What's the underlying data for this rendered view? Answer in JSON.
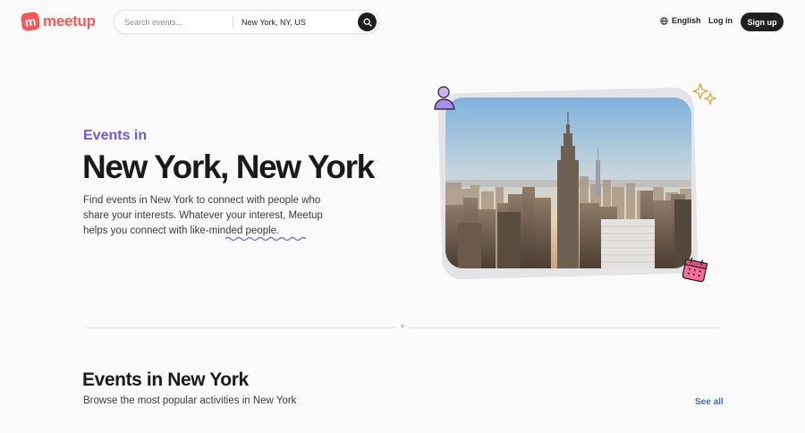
{
  "brand": {
    "logo_text": "meetup",
    "logo_mark": "m",
    "color": "#f65858"
  },
  "search": {
    "placeholder": "Search events...",
    "location_value": "New York, NY, US",
    "button_icon": "search-icon"
  },
  "nav": {
    "language_icon": "globe-icon",
    "language": "English",
    "login": "Log in",
    "signup": "Sign up"
  },
  "hero": {
    "eyebrow": "Events in",
    "title": "New York, New York",
    "description": "Find events in New York to connect with people who share your interests. Whatever your interest, Meetup helps you connect with like-minded people.",
    "image_alt": "New York City skyline with the Empire State Building",
    "accent_color": "#7058d6"
  },
  "events": {
    "title": "Events in New York",
    "subtitle": "Browse the most popular activities in New York",
    "see_all": "See all",
    "link_color": "#3a6fc4"
  }
}
